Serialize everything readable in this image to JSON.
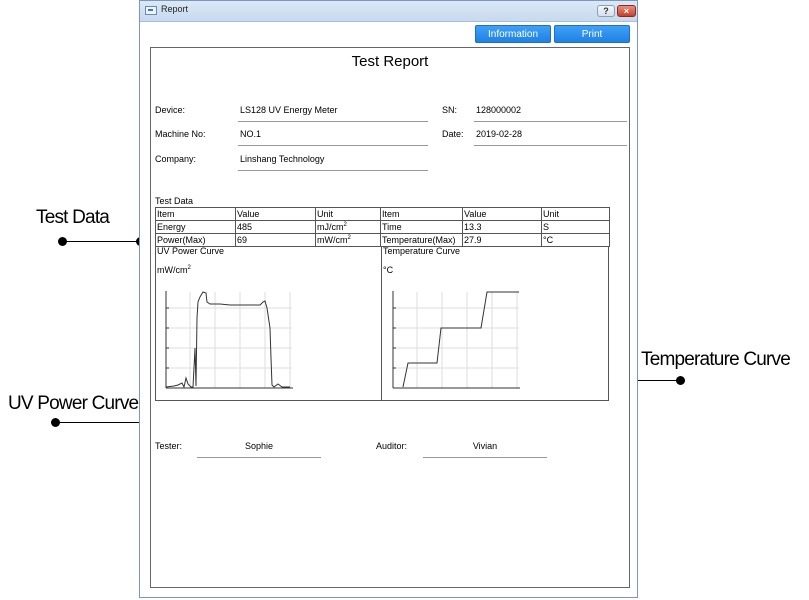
{
  "annotations": {
    "test_data": "Test Data",
    "temperature_curve": "Temperature Curve",
    "uv_power_curve": "UV Power Curve"
  },
  "window": {
    "title": "Report",
    "help_label": "?",
    "close_label": "×"
  },
  "toolbar": {
    "information_label": "Information",
    "print_label": "Print"
  },
  "report": {
    "title": "Test Report",
    "device_label": "Device:",
    "device_value": "LS128 UV Energy Meter",
    "sn_label": "SN:",
    "sn_value": "128000002",
    "machine_label": "Machine No:",
    "machine_value": "NO.1",
    "date_label": "Date:",
    "date_value": "2019-02-28",
    "company_label": "Company:",
    "company_value": "Linshang Technology",
    "test_data_label": "Test Data",
    "table": {
      "headers": [
        "Item",
        "Value",
        "Unit",
        "Item",
        "Value",
        "Unit"
      ],
      "row1": [
        "Energy",
        "485",
        "mJ/cm",
        "Time",
        "13.3",
        "S"
      ],
      "row2": [
        "Power(Max)",
        "69",
        "mW/cm",
        "Temperature(Max)",
        "27.9",
        "°C"
      ],
      "superscript": "2"
    },
    "uv_curve_title": "UV Power Curve",
    "uv_curve_unit": "mW/cm",
    "uv_curve_unit_sup": "2",
    "temp_curve_title": "Temperature Curve",
    "temp_curve_unit": "°C",
    "tester_label": "Tester:",
    "tester_value": "Sophie",
    "auditor_label": "Auditor:",
    "auditor_value": "Vivian"
  }
}
